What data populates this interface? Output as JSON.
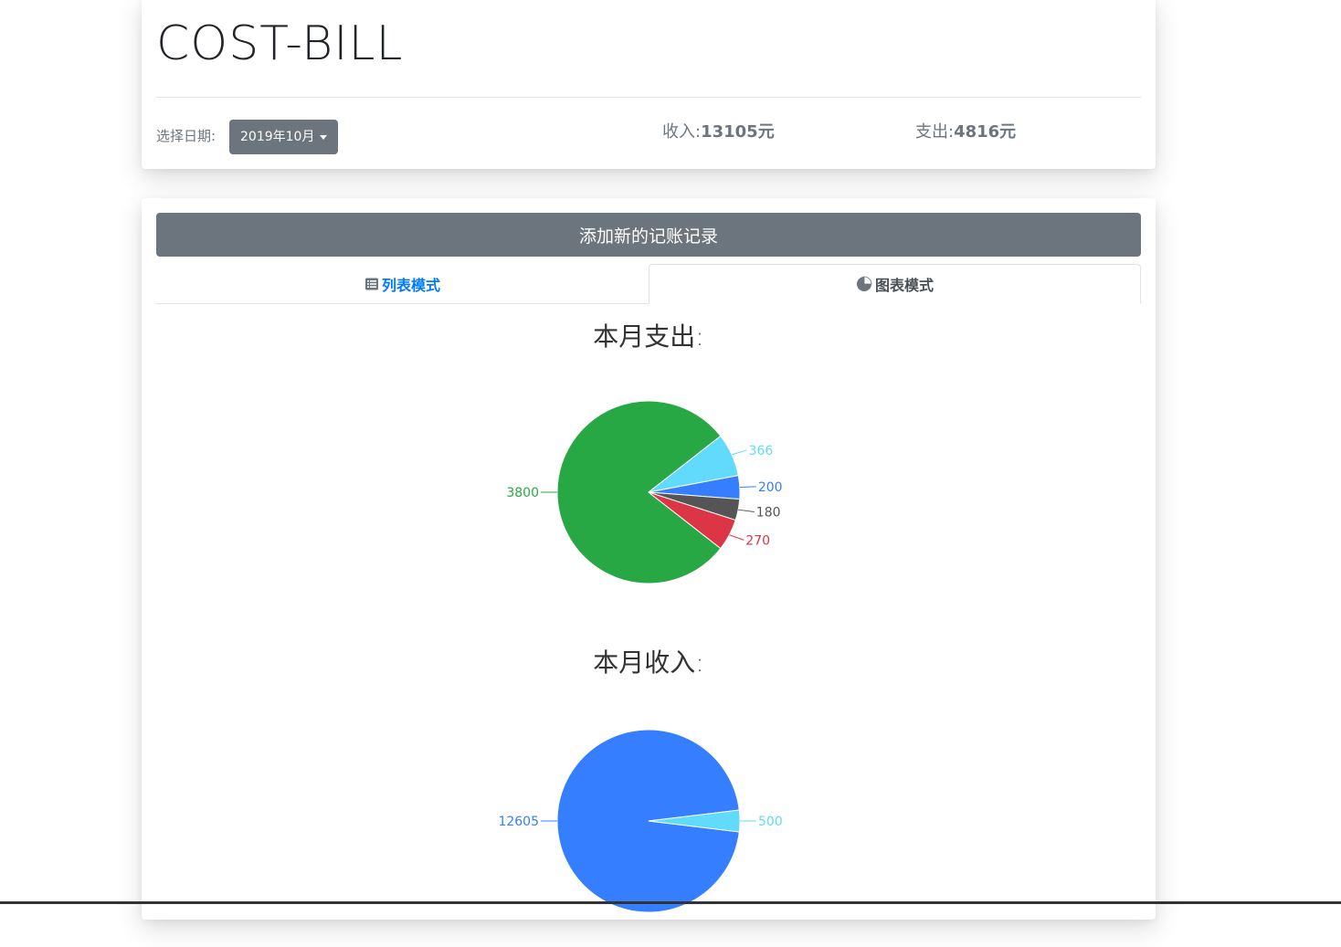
{
  "app": {
    "title": "COST-BILL"
  },
  "header": {
    "date_label": "选择日期:",
    "date_value": "2019年10月",
    "income_label": "收入:",
    "income_value": "13105元",
    "expense_label": "支出:",
    "expense_value": "4816元"
  },
  "main": {
    "add_button": "添加新的记账记录",
    "tabs": [
      {
        "label": "列表模式",
        "icon": "list-icon",
        "active": false
      },
      {
        "label": "图表模式",
        "icon": "pie-chart-icon",
        "active": true
      }
    ]
  },
  "chart_data": [
    {
      "type": "pie",
      "title": "本月支出:",
      "values": [
        3800,
        366,
        200,
        180,
        270
      ],
      "labels": [
        "3800",
        "366",
        "200",
        "180",
        "270"
      ],
      "colors": [
        "#28a745",
        "#61dafb",
        "#347eff",
        "#555555",
        "#dc3545"
      ]
    },
    {
      "type": "pie",
      "title": "本月收入:",
      "values": [
        12605,
        500
      ],
      "labels": [
        "12605",
        "500"
      ],
      "colors": [
        "#347eff",
        "#61dafb"
      ]
    }
  ]
}
